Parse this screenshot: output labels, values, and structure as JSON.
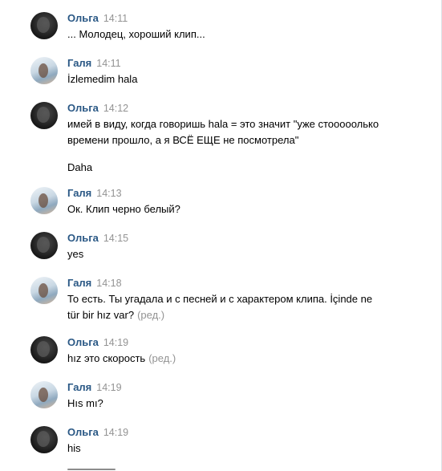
{
  "messages": [
    {
      "author": "Ольга",
      "time": "14:11",
      "text": "... Молодец, хороший клип...",
      "edited": ""
    },
    {
      "author": "Галя",
      "time": "14:11",
      "text": "İzlemedim hala",
      "edited": ""
    },
    {
      "author": "Ольга",
      "time": "14:12",
      "text": "имей в виду, когда говоришь hala = это значит \"уже стооооолько времени прошло, а я ВСЁ ЕЩЕ не посмотрела\"",
      "extra": "Daha",
      "edited": ""
    },
    {
      "author": "Галя",
      "time": "14:13",
      "text": "Ок. Клип черно белый?",
      "edited": ""
    },
    {
      "author": "Ольга",
      "time": "14:15",
      "text": "yes",
      "edited": ""
    },
    {
      "author": "Галя",
      "time": "14:18",
      "text": "То есть. Ты угадала и с песней и с характером клипа. İçinde ne tür bir hız var?",
      "edited": "(ред.)"
    },
    {
      "author": "Ольга",
      "time": "14:19",
      "text": "hız это скорость",
      "edited": "(ред.)"
    },
    {
      "author": "Галя",
      "time": "14:19",
      "text": "Hıs mı?",
      "edited": ""
    },
    {
      "author": "Ольга",
      "time": "14:19",
      "text": "his",
      "edited": ""
    }
  ],
  "colors": {
    "author": "#2a5885",
    "meta": "#939393",
    "text": "#000000",
    "background": "#ffffff"
  }
}
